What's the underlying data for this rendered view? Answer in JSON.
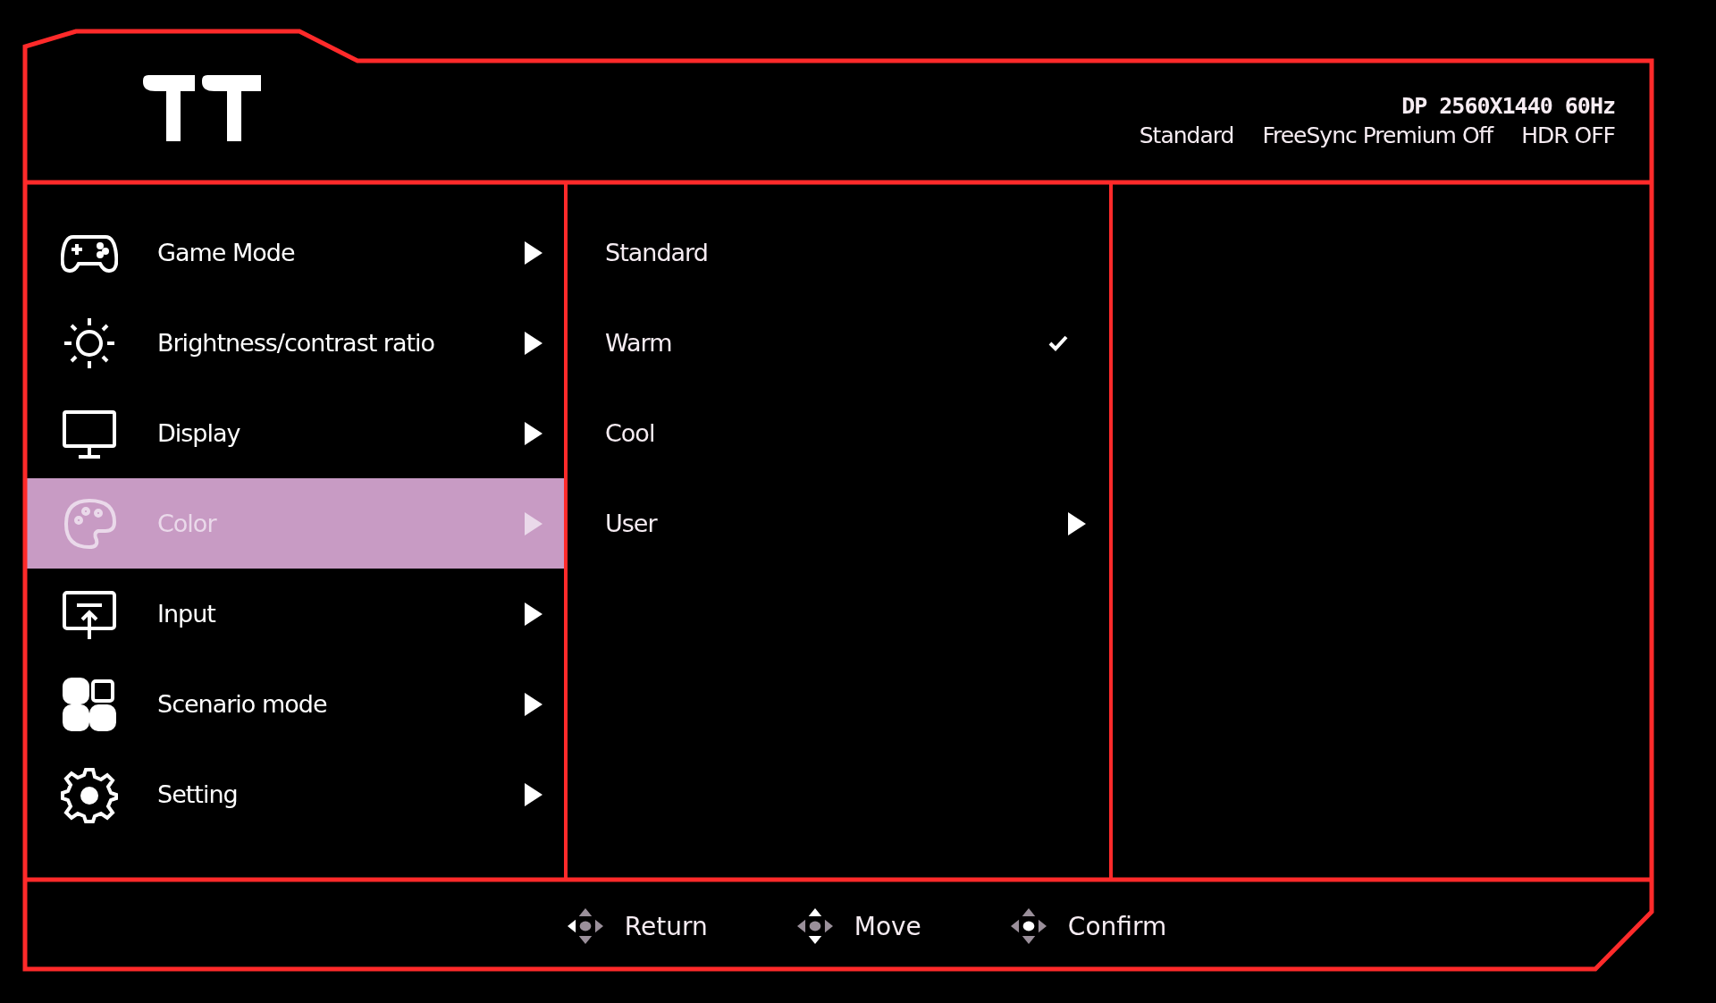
{
  "header": {
    "signal": "DP 2560X1440 60Hz",
    "status": [
      "Standard",
      "FreeSync Premium Off",
      "HDR OFF"
    ]
  },
  "menu": {
    "items": [
      {
        "label": "Game Mode",
        "kind": "gamepad",
        "selected": false
      },
      {
        "label": "Brightness/contrast ratio",
        "kind": "brightness",
        "selected": false
      },
      {
        "label": "Display",
        "kind": "monitor",
        "selected": false
      },
      {
        "label": "Color",
        "kind": "palette",
        "selected": true
      },
      {
        "label": "Input",
        "kind": "input",
        "selected": false
      },
      {
        "label": "Scenario mode",
        "kind": "tiles",
        "selected": false
      },
      {
        "label": "Setting",
        "kind": "gear",
        "selected": false
      }
    ]
  },
  "submenu": {
    "items": [
      {
        "label": "Standard",
        "checked": false,
        "has_submenu": false
      },
      {
        "label": "Warm",
        "checked": true,
        "has_submenu": false
      },
      {
        "label": "Cool",
        "checked": false,
        "has_submenu": false
      },
      {
        "label": "User",
        "checked": false,
        "has_submenu": true
      }
    ]
  },
  "footer": {
    "hints": [
      {
        "label": "Return",
        "kind": "return"
      },
      {
        "label": "Move",
        "kind": "move"
      },
      {
        "label": "Confirm",
        "kind": "confirm"
      }
    ]
  }
}
